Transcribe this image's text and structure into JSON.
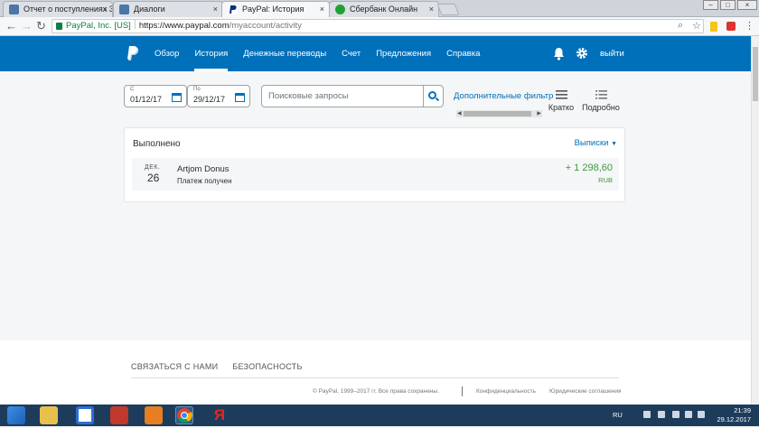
{
  "browser": {
    "tabs": [
      {
        "title": "Отчет о поступлениях 3",
        "icon": "vk-icon"
      },
      {
        "title": "Диалоги",
        "icon": "vk-icon"
      },
      {
        "title": "PayPal: История",
        "icon": "paypal-icon",
        "active": true
      },
      {
        "title": "Сбербанк Онлайн",
        "icon": "sberbank-icon"
      }
    ],
    "address": {
      "secure_label": "PayPal, Inc. [US]",
      "host": "https://www.paypal.com",
      "path": "/myaccount/activity"
    }
  },
  "header": {
    "nav": [
      "Обзор",
      "История",
      "Денежные переводы",
      "Счет",
      "Предложения",
      "Справка"
    ],
    "logout": "выйти"
  },
  "filters": {
    "from_label": "С",
    "from_value": "01/12/17",
    "to_label": "По",
    "to_value": "29/12/17",
    "search_placeholder": "Поисковые запросы",
    "more_filters": "Дополнительные фильтр",
    "view_brief": "Кратко",
    "view_detailed": "Подробно"
  },
  "activity": {
    "section_title": "Выполнено",
    "statements": "Выписки",
    "transaction": {
      "month": "ДЕК.",
      "day": "26",
      "name": "Artjom Donus",
      "status": "Платеж получен",
      "amount": "+ 1 298,60",
      "currency": "RUB"
    }
  },
  "footer": {
    "contact": "СВЯЗАТЬСЯ С НАМИ",
    "security": "БЕЗОПАСНОСТЬ",
    "copyright": "© PayPal, 1999–2017 гг. Все права сохранены.",
    "privacy": "Конфиденциальность",
    "legal": "Юридические соглашения"
  },
  "taskbar": {
    "lang": "RU",
    "time": "21:39",
    "date": "29.12.2017"
  },
  "colors": {
    "paypal_blue": "#0070ba",
    "amount_green": "#3d9a3d"
  }
}
